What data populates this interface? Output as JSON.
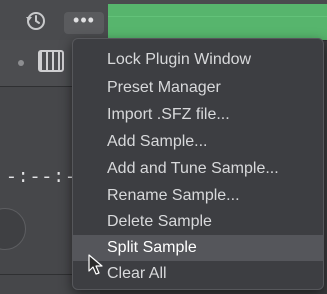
{
  "toolbar": {
    "history_icon": "history-icon",
    "more_label": "•••"
  },
  "left_panel": {
    "time_readout": "-:--:--",
    "piano_icon": "piano-keys-icon"
  },
  "context_menu": {
    "items": [
      {
        "label": "Lock Plugin Window"
      },
      {
        "label": "Preset Manager"
      },
      {
        "label": "Import .SFZ file..."
      },
      {
        "label": "Add Sample..."
      },
      {
        "label": "Add and Tune Sample..."
      },
      {
        "label": "Rename Sample..."
      },
      {
        "label": "Delete Sample"
      },
      {
        "label": "Split Sample",
        "highlighted": true
      },
      {
        "label": "Clear All"
      }
    ]
  },
  "colors": {
    "accent_green": "#57b56d",
    "menu_bg": "#3d3e42",
    "highlight": "#55565b"
  }
}
